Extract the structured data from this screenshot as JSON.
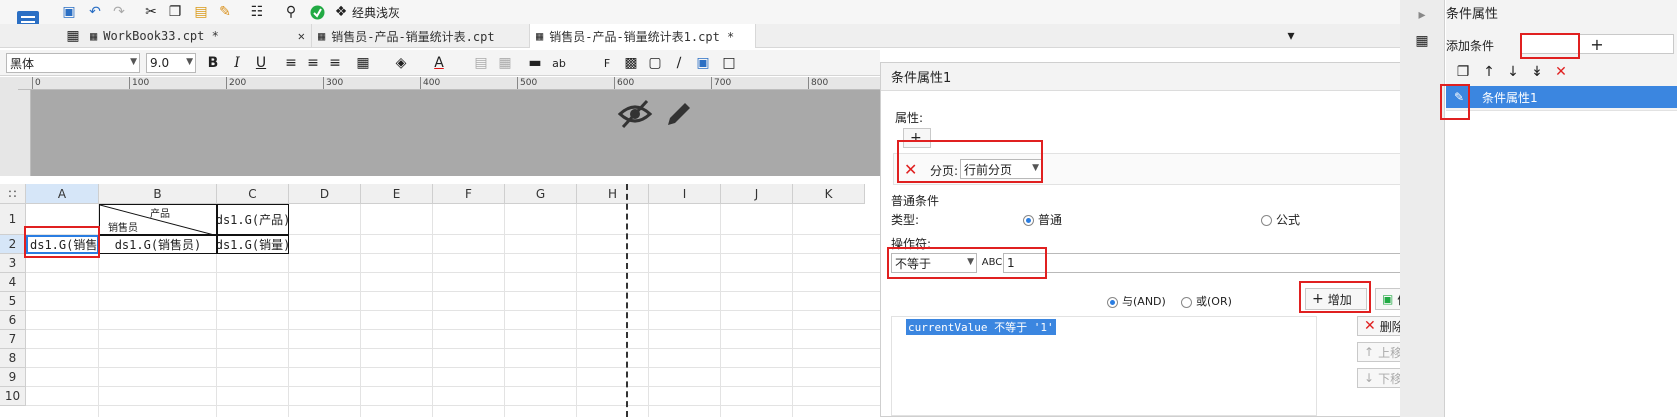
{
  "toolbar": {
    "classic_theme_label": "经典浅灰"
  },
  "tabs": [
    {
      "label": "WorkBook33.cpt *"
    },
    {
      "label": "销售员-产品-销量统计表.cpt"
    },
    {
      "label": "销售员-产品-销量统计表1.cpt *"
    }
  ],
  "format": {
    "font_name": "黑体",
    "font_size": "9.0"
  },
  "ruler": {
    "ticks": [
      "0",
      "100",
      "200",
      "300",
      "400",
      "500",
      "600",
      "700",
      "800"
    ]
  },
  "grid": {
    "columns": [
      "A",
      "B",
      "C",
      "D",
      "E",
      "F",
      "G",
      "H",
      "I",
      "J",
      "K"
    ],
    "rows": [
      "1",
      "2",
      "3",
      "4",
      "5",
      "6",
      "7",
      "8",
      "9",
      "10"
    ],
    "cells": {
      "b1_top": "产品",
      "b1_bottom": "销售员",
      "c1": "ds1.G(产品)",
      "a2": "ds1.G(销售",
      "b2": "ds1.G(销售员)",
      "c2": "ds1.G(销量)"
    }
  },
  "dialog": {
    "title": "条件属性1",
    "attr_label": "属性:",
    "paging_label": "分页:",
    "paging_value": "行前分页",
    "normal_condition_label": "普通条件",
    "type_label": "类型:",
    "type_normal": "普通",
    "type_formula": "公式",
    "operator_label": "操作符:",
    "operator_value": "不等于",
    "operand_value": "1",
    "and_label": "与(AND)",
    "or_label": "或(OR)",
    "add_label": "增加",
    "modify_label": "修改",
    "condition_item": "currentValue 不等于 '1'",
    "delete_label": "删除",
    "up_label": "上移",
    "down_label": "下移"
  },
  "right_panel": {
    "title": "条件属性",
    "add_condition_label": "添加条件",
    "list_item": "条件属性1"
  }
}
